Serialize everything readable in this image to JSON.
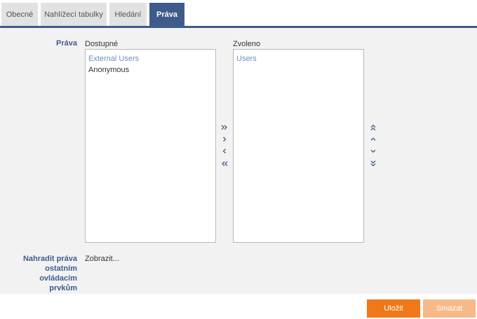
{
  "tabs": [
    {
      "label": "Obecné",
      "active": false
    },
    {
      "label": "Nahlížecí tabulky",
      "active": false
    },
    {
      "label": "Hledání",
      "active": false
    },
    {
      "label": "Práva",
      "active": true
    }
  ],
  "rights": {
    "label": "Práva",
    "available": {
      "caption": "Dostupné",
      "items": [
        {
          "label": "External Users",
          "type": "group"
        },
        {
          "label": "Anonymous",
          "type": "user"
        }
      ]
    },
    "selected": {
      "caption": "Zvoleno",
      "items": [
        {
          "label": "Users",
          "type": "group"
        }
      ]
    }
  },
  "replace_rights": {
    "label_lines": [
      "Nahradit práva",
      "ostatním",
      "ovládacím",
      "prvkům"
    ],
    "link": "Zobrazit..."
  },
  "footer": {
    "save_label": "Uložit",
    "delete_label": "Smazat"
  },
  "colors": {
    "accent": "#3f5b8c",
    "save": "#f07818",
    "delete": "#f7b987",
    "group_item": "#6c8ebf"
  }
}
